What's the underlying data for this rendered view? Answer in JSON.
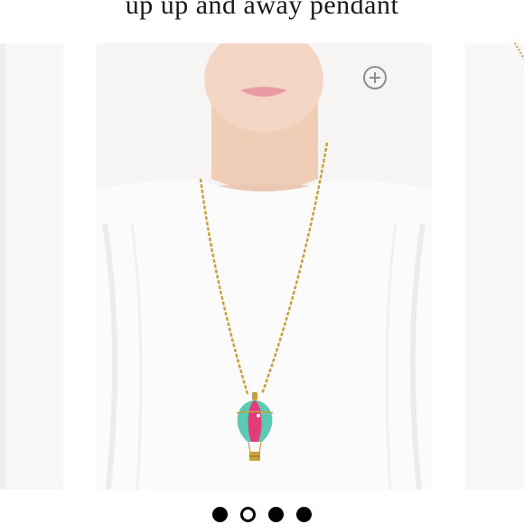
{
  "product": {
    "title": "up up and away pendant"
  },
  "gallery": {
    "total_slides": 4,
    "active_index": 1,
    "zoom_icon": "zoom-plus-icon"
  },
  "colors": {
    "background": "#ffffff",
    "dot_fill": "#000000",
    "zoom_icon_stroke": "#8e8e8e"
  }
}
